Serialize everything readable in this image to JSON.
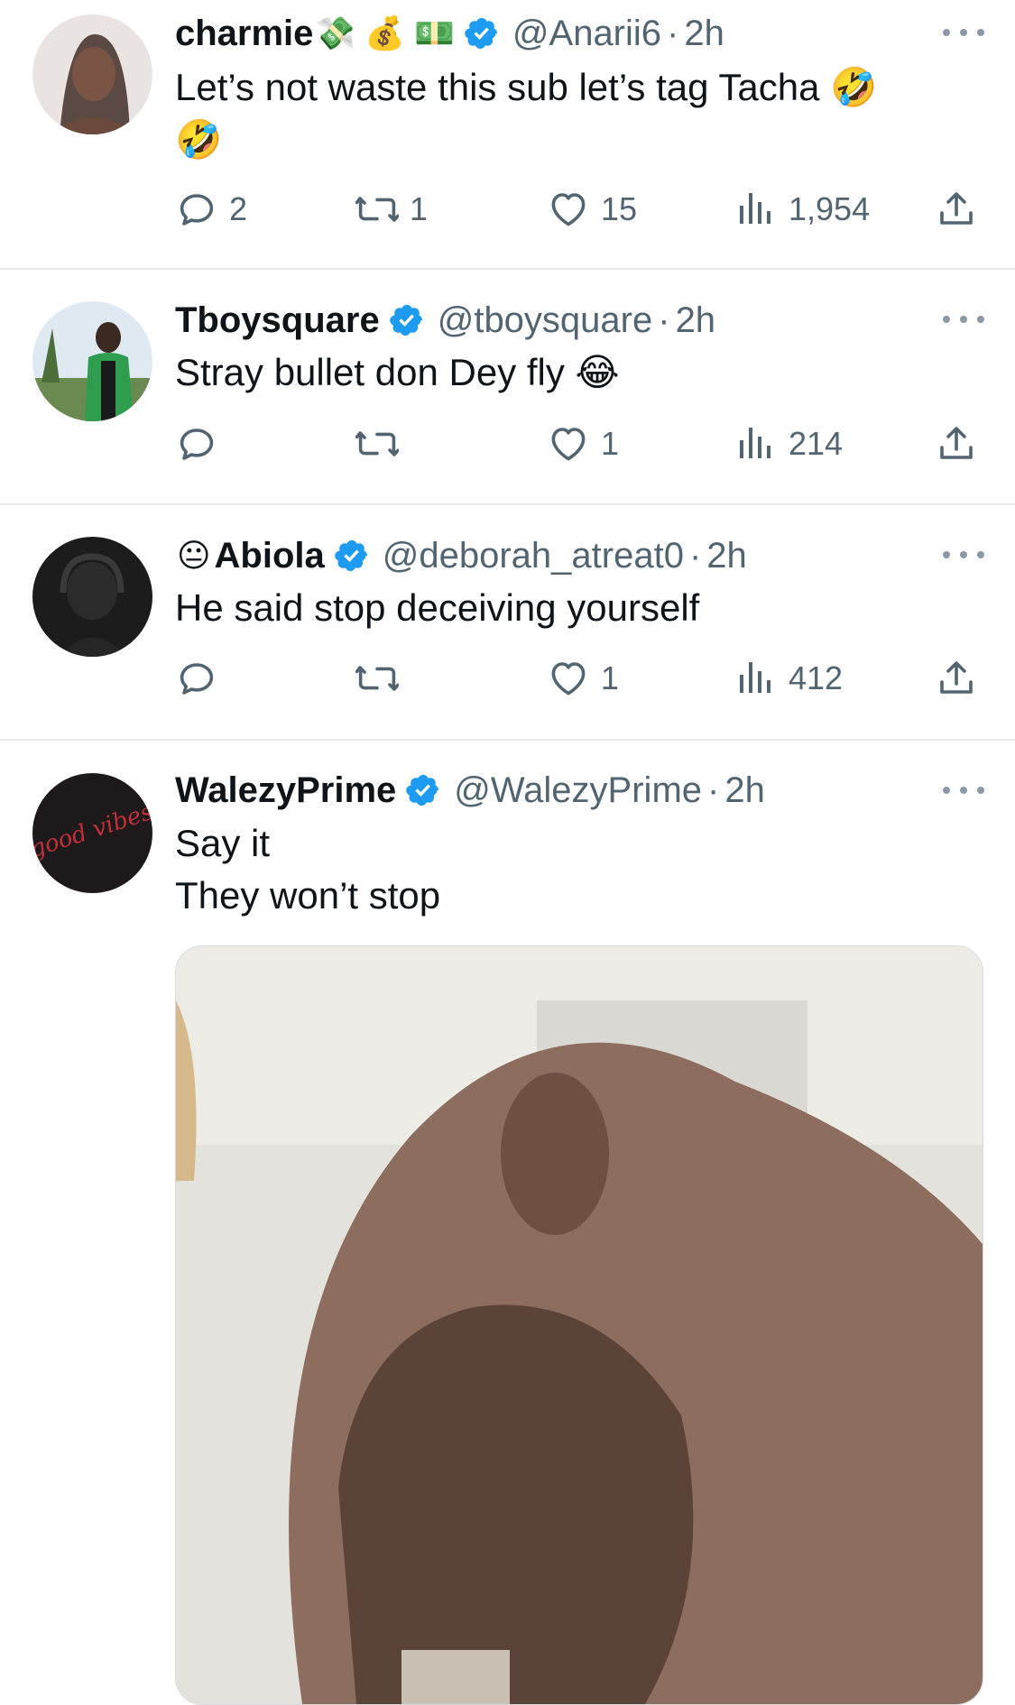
{
  "replies": [
    {
      "name": "charmie",
      "name_emojis": "💸 💰 💵",
      "handle": "@Anarii6",
      "separator": "·",
      "time": "2h",
      "text": "Let’s not waste this sub let’s tag Tacha 🤣\n🤣",
      "reply_count": "2",
      "retweet_count": "1",
      "like_count": "15",
      "view_count": "1,954"
    },
    {
      "name": "Tboysquare",
      "handle": "@tboysquare",
      "separator": "·",
      "time": "2h",
      "text": "Stray bullet don Dey fly 😂",
      "reply_count": "",
      "retweet_count": "",
      "like_count": "1",
      "view_count": "214"
    },
    {
      "name_prefix_emoji": "😐",
      "name": "Abiola",
      "handle": "@deborah_atreat0",
      "separator": "·",
      "time": "2h",
      "text": "He said stop deceiving yourself",
      "reply_count": "",
      "retweet_count": "",
      "like_count": "1",
      "view_count": "412"
    },
    {
      "name": "WalezyPrime",
      "handle": "@WalezyPrime",
      "separator": "·",
      "time": "2h",
      "text": "Say it\nThey won’t stop"
    }
  ],
  "avatar_4_text": "good vibes",
  "icons": {
    "reply": "reply-icon",
    "retweet": "retweet-icon",
    "like": "heart-icon",
    "views": "views-icon",
    "share": "share-icon",
    "more": "more-icon",
    "verified": "verified-badge-icon"
  },
  "colors": {
    "text": "#0f1419",
    "secondary": "#536471",
    "verified": "#1d9bf0",
    "divider": "#e7e9ea"
  }
}
